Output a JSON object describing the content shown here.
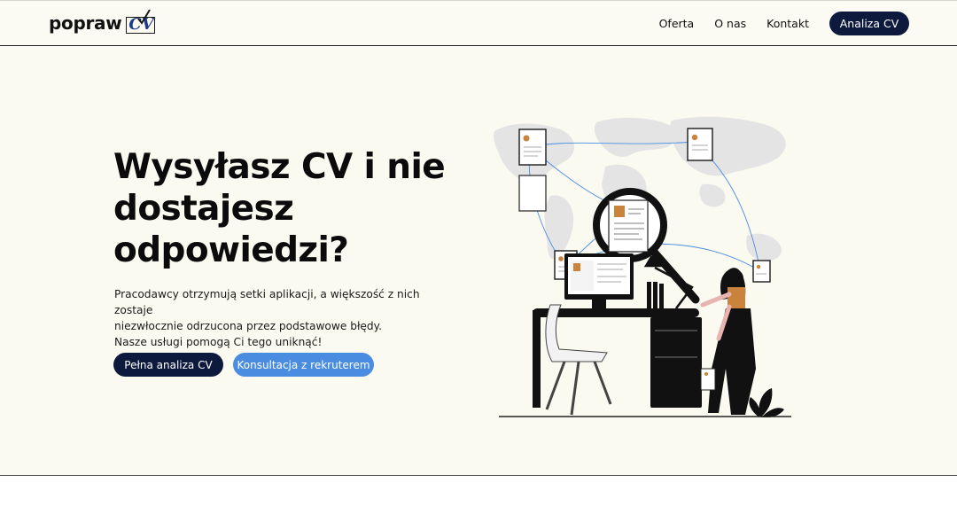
{
  "header": {
    "logo_text": "popraw",
    "logo_mark_text": "CV",
    "nav": [
      {
        "label": "Oferta"
      },
      {
        "label": "O nas"
      },
      {
        "label": "Kontakt"
      }
    ],
    "cta_label": "Analiza CV"
  },
  "hero": {
    "headline": "Wysyłasz CV i nie dostajesz odpowiedzi?",
    "subtext_lines": [
      "Pracodawcy otrzymują setki aplikacji, a większość z nich zostaje",
      "niezwłocznie odrzucona przez podstawowe błędy.",
      "Nasze usługi pomogą Ci tego uniknąć!"
    ],
    "primary_button": "Pełna analiza CV",
    "secondary_button": "Konsultacja z rekruterem"
  },
  "illustration": {
    "icons": [
      "world-map",
      "cv-document",
      "magnifier",
      "woman",
      "desk",
      "monitor",
      "chair",
      "lamp",
      "plant"
    ]
  },
  "colors": {
    "navy": "#0e1a3d",
    "accent_blue": "#4a8de0",
    "background": "#fbfaf1",
    "skin_orange": "#c9833a"
  }
}
